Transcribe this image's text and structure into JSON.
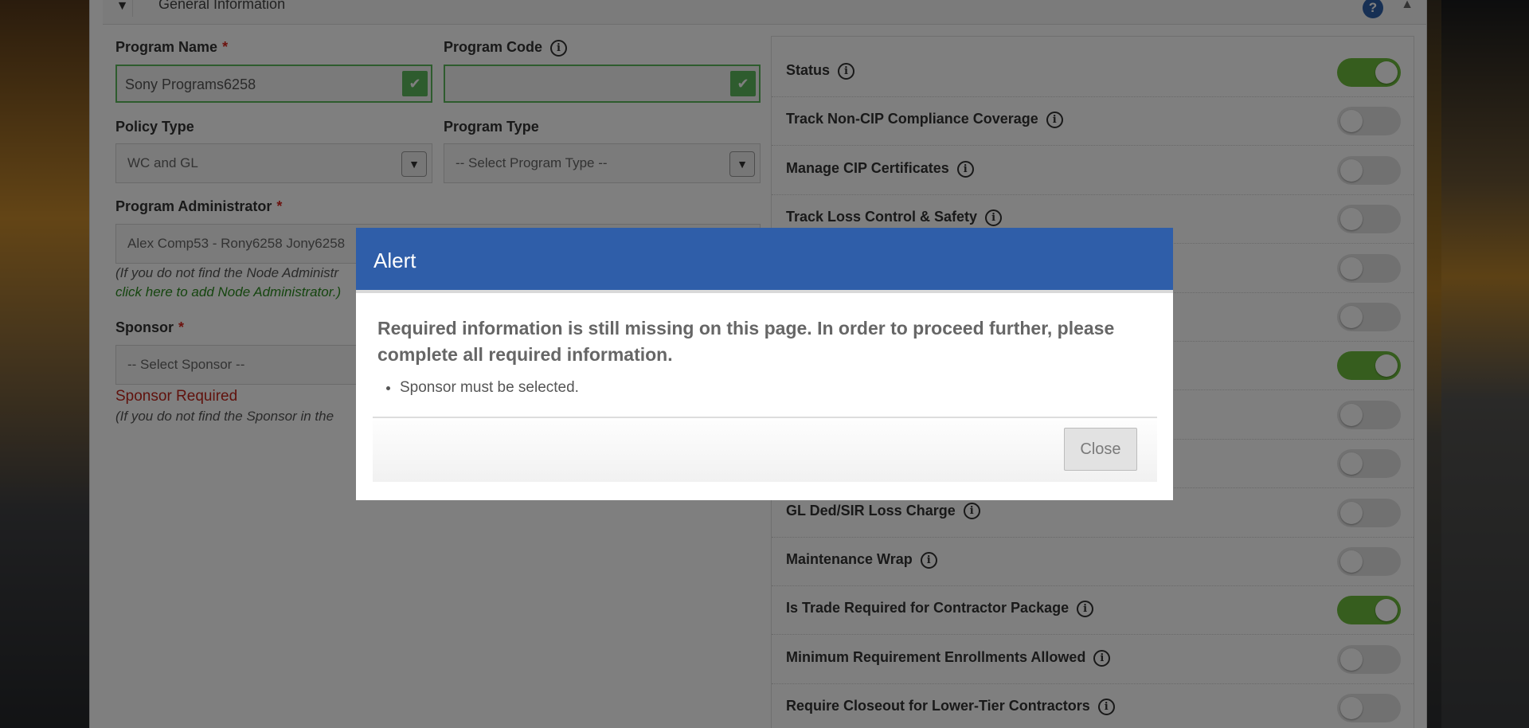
{
  "panel": {
    "title": "General Information",
    "help_glyph": "?",
    "collapse_glyph": "▲"
  },
  "form": {
    "program_name": {
      "label": "Program Name",
      "required": "*",
      "value": "Sony Programs6258"
    },
    "program_code": {
      "label": "Program Code",
      "value": ""
    },
    "policy_type": {
      "label": "Policy Type",
      "value": "WC and GL"
    },
    "program_type": {
      "label": "Program Type",
      "value": "-- Select Program Type --"
    },
    "program_administrator": {
      "label": "Program Administrator",
      "required": "*",
      "value": "Alex Comp53 - Rony6258 Jony6258",
      "hint": "(If you do not find the Node Administr",
      "add_link": "click here to add Node Administrator.)"
    },
    "sponsor": {
      "label": "Sponsor",
      "required": "*",
      "value": "-- Select Sponsor --",
      "error": "Sponsor Required",
      "hint": "(If you do not find the Sponsor in the"
    }
  },
  "toggles": [
    {
      "label": "Status",
      "on": true
    },
    {
      "label": "Track Non-CIP Compliance Coverage",
      "on": false
    },
    {
      "label": "Manage CIP Certificates",
      "on": false
    },
    {
      "label": "Track Loss Control & Safety",
      "on": false
    },
    {
      "label": "",
      "on": false
    },
    {
      "label": "",
      "on": false
    },
    {
      "label": "",
      "on": true
    },
    {
      "label": "",
      "on": false
    },
    {
      "label": "",
      "on": false
    },
    {
      "label": "GL Ded/SIR Loss Charge",
      "on": false
    },
    {
      "label": "Maintenance Wrap",
      "on": false
    },
    {
      "label": "Is Trade Required for Contractor Package",
      "on": true
    },
    {
      "label": "Minimum Requirement Enrollments Allowed",
      "on": false
    },
    {
      "label": "Require Closeout for Lower-Tier Contractors",
      "on": false
    }
  ],
  "modal": {
    "title": "Alert",
    "message": "Required information is still missing on this page. In order to proceed further, please complete all required information.",
    "items": [
      "Sponsor must be selected."
    ],
    "close_label": "Close"
  },
  "colors": {
    "modal_header": "#2f5ea9",
    "toggle_on": "#6cbb3c",
    "valid_green": "#5cb85c",
    "error_red": "#c0251a"
  }
}
